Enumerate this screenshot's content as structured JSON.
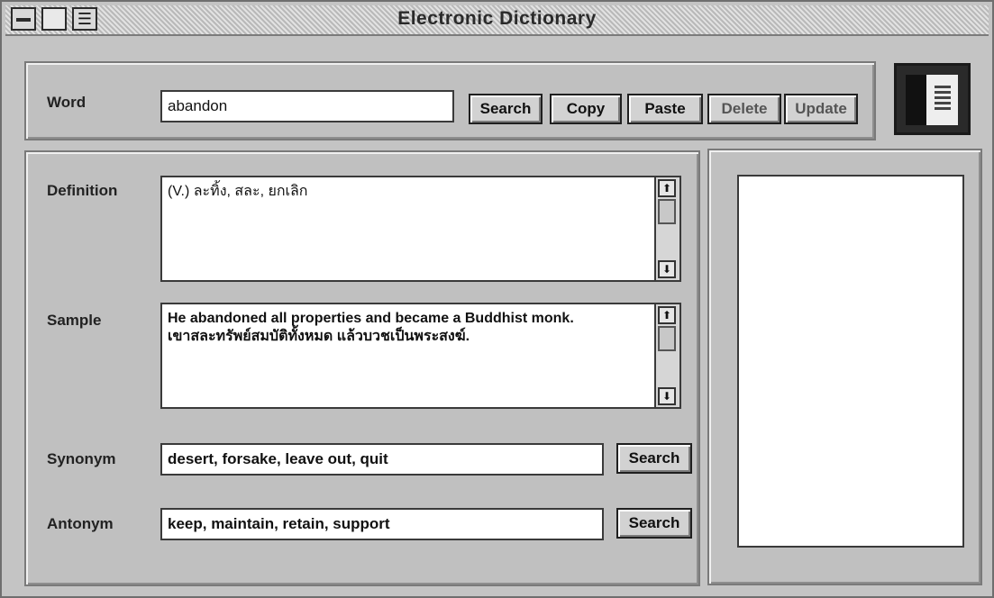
{
  "window": {
    "title": "Electronic Dictionary"
  },
  "icons": {
    "system_menu": "minus-icon",
    "document": "document-icon",
    "logo": "staircase-logo-icon",
    "scroll_up": "arrow-up-icon",
    "scroll_down": "arrow-down-icon"
  },
  "word": {
    "label": "Word",
    "value": "abandon"
  },
  "toolbar": {
    "search_label": "Search",
    "copy_label": "Copy",
    "paste_label": "Paste",
    "delete_label": "Delete",
    "update_label": "Update"
  },
  "definition": {
    "label": "Definition",
    "value": "(V.) ละทิ้ง, สละ, ยกเลิก"
  },
  "sample": {
    "label": "Sample",
    "value": "He abandoned all properties and became a Buddhist monk.\nเขาสละทรัพย์สมบัติทั้งหมด แล้วบวชเป็นพระสงฆ์."
  },
  "synonym": {
    "label": "Synonym",
    "value": "desert, forsake, leave out, quit",
    "search_label": "Search"
  },
  "antonym": {
    "label": "Antonym",
    "value": "keep, maintain, retain, support",
    "search_label": "Search"
  },
  "scroll_glyphs": {
    "up": "⬆",
    "down": "⬇"
  }
}
